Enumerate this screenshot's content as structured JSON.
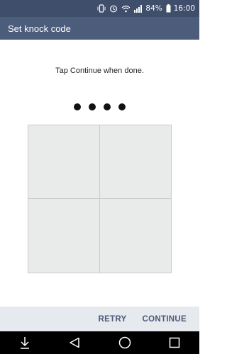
{
  "status_bar": {
    "battery_percent": "84%",
    "time": "16:00",
    "icons": [
      "vibrate-icon",
      "alarm-icon",
      "wifi-icon",
      "signal-icon",
      "battery-icon"
    ]
  },
  "header": {
    "title": "Set knock code"
  },
  "main": {
    "instruction": "Tap Continue when done.",
    "entered_dots": 4,
    "pad_cells": 4
  },
  "actions": {
    "retry_label": "RETRY",
    "continue_label": "CONTINUE"
  },
  "nav": {
    "buttons": [
      "down-arrow-icon",
      "back-icon",
      "home-icon",
      "recents-icon"
    ]
  },
  "colors": {
    "status_bar": "#3f4e6a",
    "title_bar": "#4c5d7c",
    "action_text": "#4a5a78",
    "pad": "#e9eaea"
  }
}
